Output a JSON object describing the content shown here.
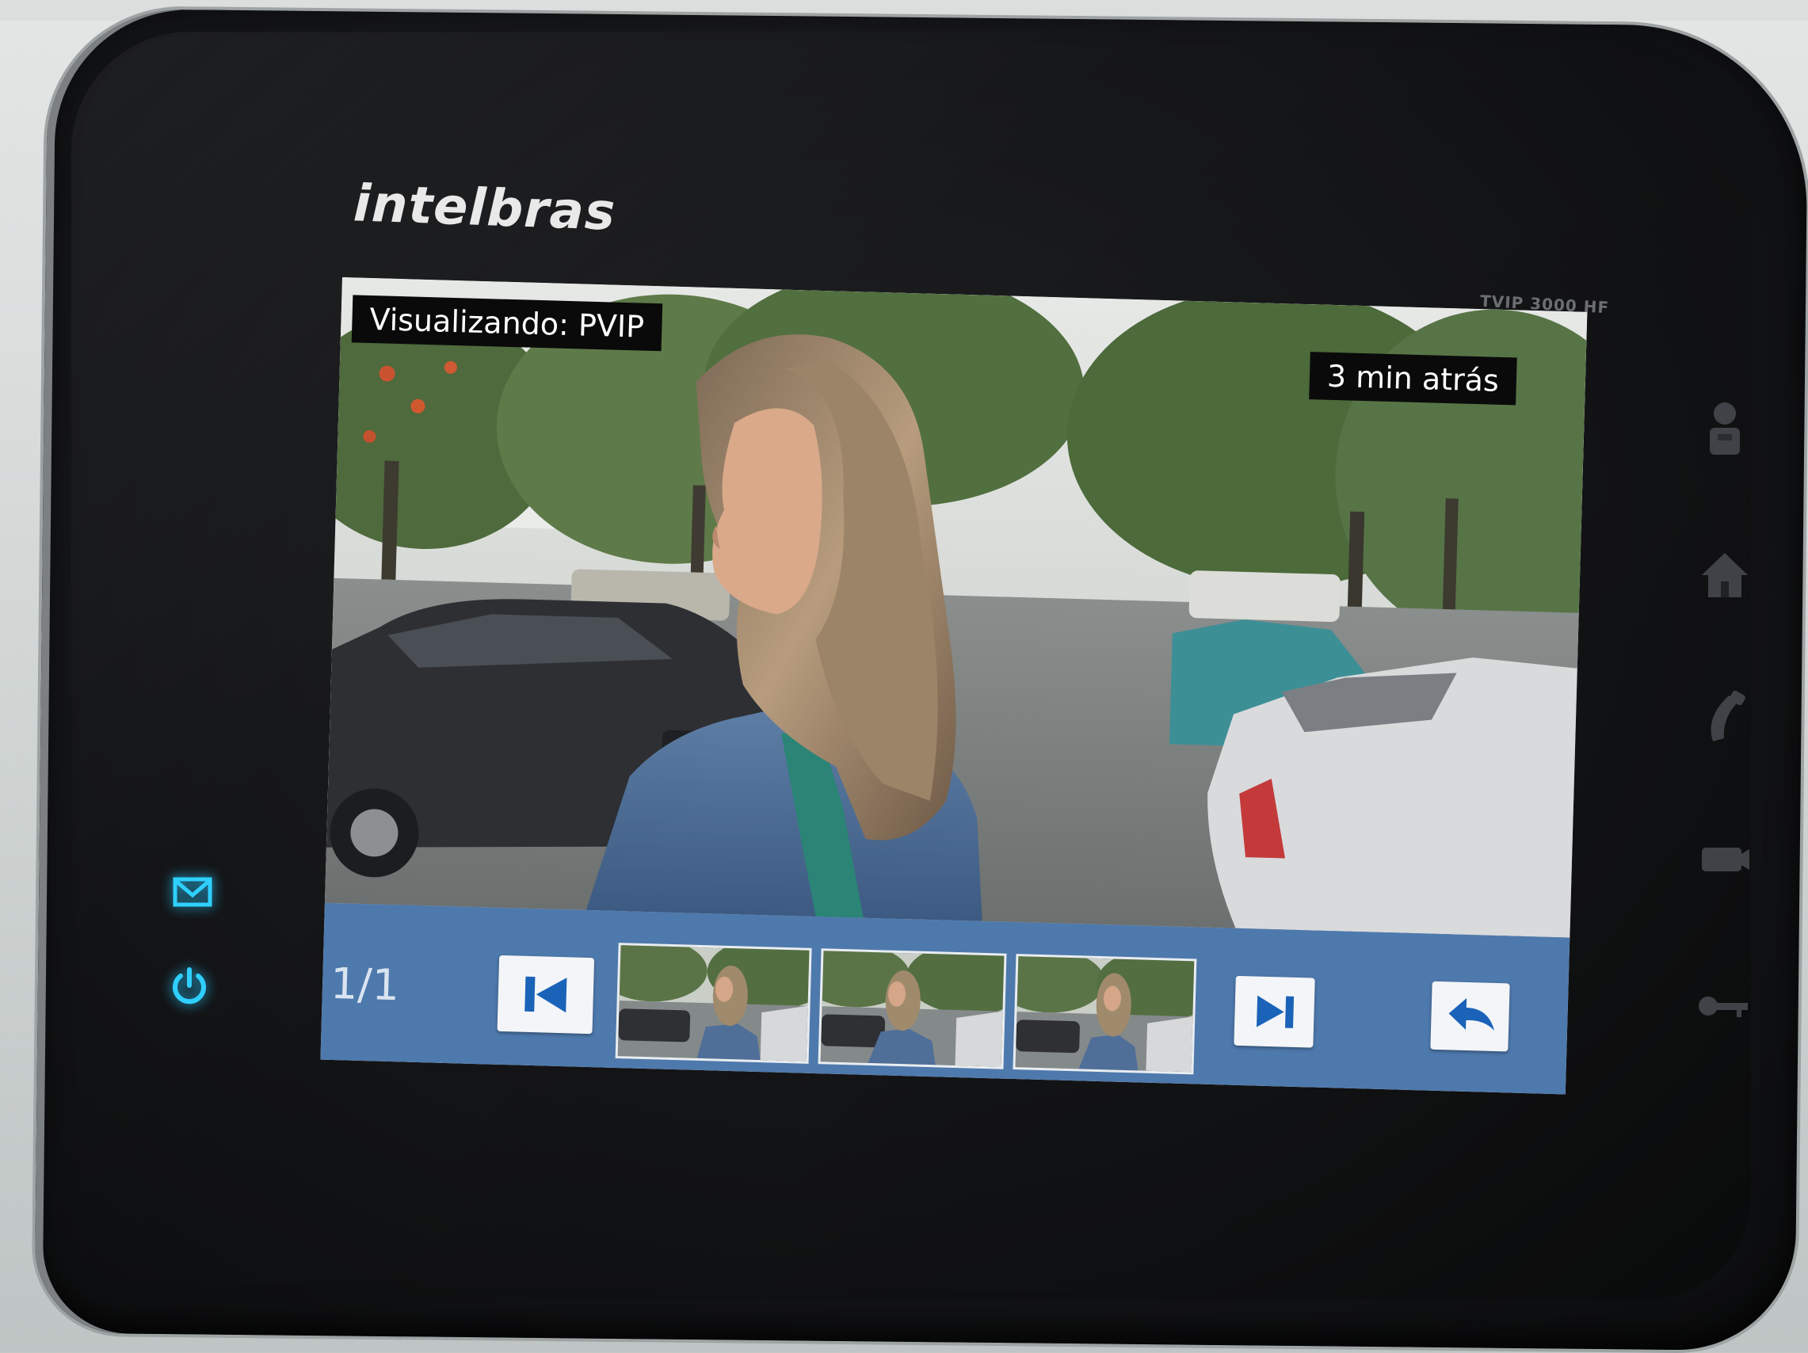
{
  "device": {
    "brand": "intelbras",
    "model": "TVIP 3000 HF"
  },
  "viewer": {
    "source_label": "Visualizando: PVIP",
    "time_label": "3 min atrás"
  },
  "playback": {
    "page_counter": "1/1",
    "thumbnail_count": 3
  },
  "icons": {
    "first": "skip-previous-icon",
    "next": "skip-next-icon",
    "back": "undo-arrow-icon",
    "mail": "mail-icon",
    "power": "power-icon",
    "side_keys": [
      "intercom-icon",
      "home-icon",
      "phone-handset-icon",
      "camera-icon",
      "key-icon"
    ]
  },
  "colors": {
    "control_bar": "#4e79ad",
    "led": "#27c8ff",
    "bezel": "#141517"
  }
}
